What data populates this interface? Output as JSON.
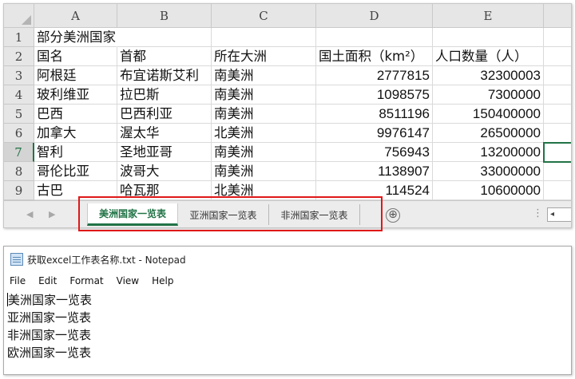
{
  "excel": {
    "corner_icon": "select-all-triangle",
    "columns": [
      "A",
      "B",
      "C",
      "D",
      "E"
    ],
    "row_numbers": [
      "1",
      "2",
      "3",
      "4",
      "5",
      "6",
      "7",
      "8",
      "9"
    ],
    "selected_row": "7",
    "title_cell": "部分美洲国家",
    "headers": [
      "国名",
      "首都",
      "所在大洲",
      "国土面积（km²）",
      "人口数量（人）"
    ],
    "rows": [
      [
        "阿根廷",
        "布宜诺斯艾利",
        "南美洲",
        "2777815",
        "32300003"
      ],
      [
        "玻利维亚",
        "拉巴斯",
        "南美洲",
        "1098575",
        "7300000"
      ],
      [
        "巴西",
        "巴西利亚",
        "南美洲",
        "8511196",
        "150400000"
      ],
      [
        "加拿大",
        "渥太华",
        "北美洲",
        "9976147",
        "26500000"
      ],
      [
        "智利",
        "圣地亚哥",
        "南美洲",
        "756943",
        "13200000"
      ],
      [
        "哥伦比亚",
        "波哥大",
        "南美洲",
        "1138907",
        "33000000"
      ],
      [
        "古巴",
        "哈瓦那",
        "北美洲",
        "114524",
        "10600000"
      ]
    ],
    "sheet_tabs": [
      "美洲国家一览表",
      "亚洲国家一览表",
      "非洲国家一览表"
    ],
    "active_tab_index": 0,
    "nav_prev_icon": "triangle-left-icon",
    "nav_next_icon": "triangle-right-icon",
    "add_sheet_icon": "⊕",
    "more_icon": "⋮",
    "scroll_left_icon": "◂",
    "accent_color": "#217346",
    "highlight_color": "#e01818"
  },
  "notepad": {
    "icon": "notepad-icon",
    "title": "获取excel工作表名称.txt - Notepad",
    "menu": [
      "File",
      "Edit",
      "Format",
      "View",
      "Help"
    ],
    "lines": [
      "美洲国家一览表",
      "亚洲国家一览表",
      "非洲国家一览表",
      "欧洲国家一览表"
    ]
  }
}
